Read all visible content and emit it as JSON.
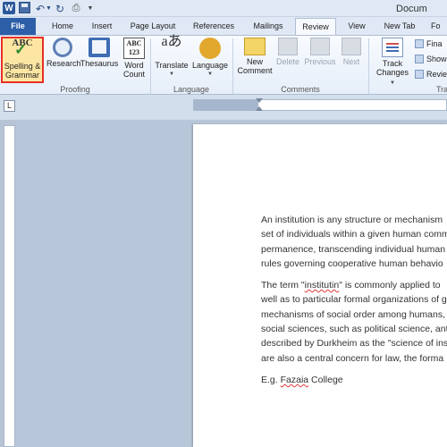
{
  "title_bar": {
    "app_logo": "W",
    "document_title": "Docum",
    "icons": [
      "word-logo",
      "save-icon",
      "undo-icon",
      "redo-icon",
      "print-icon",
      "customize-qat-icon"
    ]
  },
  "tabs": [
    {
      "label": "File"
    },
    {
      "label": "Home"
    },
    {
      "label": "Insert"
    },
    {
      "label": "Page Layout"
    },
    {
      "label": "References"
    },
    {
      "label": "Mailings"
    },
    {
      "label": "Review",
      "selected": true
    },
    {
      "label": "View"
    },
    {
      "label": "New Tab"
    },
    {
      "label": "Fo"
    }
  ],
  "ribbon": {
    "proofing": {
      "group_label": "Proofing",
      "spelling_line1": "Spelling &",
      "spelling_line2": "Grammar",
      "research": "Research",
      "thesaurus": "Thesaurus",
      "wordcount_line1": "Word",
      "wordcount_line2": "Count"
    },
    "language": {
      "group_label": "Language",
      "translate": "Translate",
      "language": "Language"
    },
    "comments": {
      "group_label": "Comments",
      "new_comment_line1": "New",
      "new_comment_line2": "Comment",
      "delete": "Delete",
      "previous": "Previous",
      "next": "Next"
    },
    "tracking": {
      "group_label": "Tra",
      "track_line1": "Track",
      "track_line2": "Changes",
      "final": "Fina",
      "show": "Show",
      "reviewing": "Revie"
    },
    "highlight_color": "#e53129",
    "accent_color": "#2d5fa8"
  },
  "ruler": {
    "corner_symbol": "L"
  },
  "document": {
    "paragraph1": [
      "An institution is any structure or mechanism",
      "set of individuals within a given human comm",
      "permanence, transcending individual human",
      "rules governing cooperative human behavio"
    ],
    "paragraph2": {
      "line1_prefix": "The term \"",
      "misspelled_word": "institutin",
      "line1_suffix": "\" is commonly applied to",
      "lines": [
        "well as to particular formal organizations of g",
        "mechanisms of social order among humans,",
        "social sciences, such as political science, anth",
        "described by Durkheim as the \"science of ins",
        "are also a central concern for law, the forma"
      ]
    },
    "paragraph3": {
      "prefix": "E.g. ",
      "flagged_text": "Fazaia",
      "suffix": " College"
    }
  }
}
